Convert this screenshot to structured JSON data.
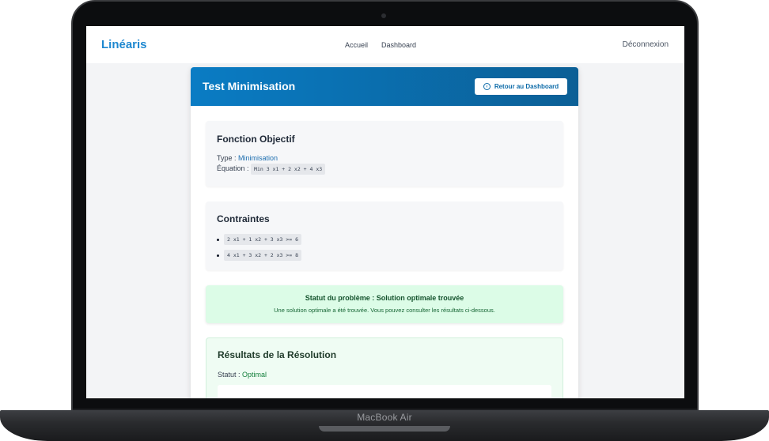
{
  "device": {
    "model": "MacBook Air"
  },
  "navbar": {
    "brand": "Linéaris",
    "links": [
      "Accueil",
      "Dashboard"
    ],
    "logout": "Déconnexion"
  },
  "card": {
    "title": "Test Minimisation",
    "back_button": "Retour au Dashboard"
  },
  "objective": {
    "heading": "Fonction Objectif",
    "type_label": "Type :",
    "type_value": "Minimisation",
    "equation_label": "Équation :",
    "equation": "Min 3 x1 + 2 x2 + 4 x3"
  },
  "constraints": {
    "heading": "Contraintes",
    "items": [
      "2 x1 + 1 x2 + 3 x3 >= 6",
      "4 x1 + 3 x2 + 2 x3 >= 8"
    ]
  },
  "status": {
    "title": "Statut du problème : Solution optimale trouvée",
    "description": "Une solution optimale a été trouvée. Vous pouvez consulter les résultats ci-dessous."
  },
  "results": {
    "heading": "Résultats de la Résolution",
    "status_label": "Statut :",
    "status_value": "Optimal"
  }
}
